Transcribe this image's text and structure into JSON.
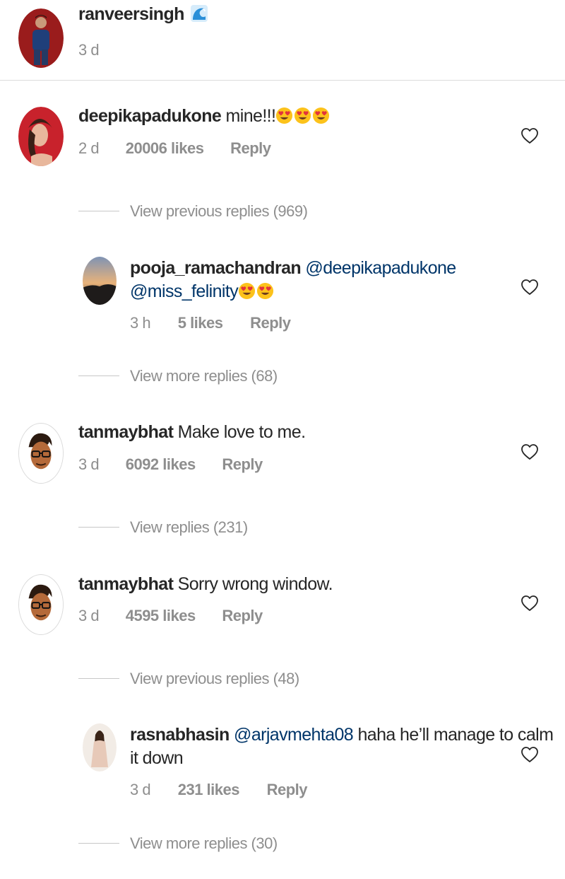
{
  "caption": {
    "username": "ranveersingh",
    "emoji_icon": "wave-emoji",
    "time": "3 d"
  },
  "comments": [
    {
      "username": "deepikapadukone",
      "text": "mine!!!",
      "emoji": "heart-eyes-emoji x3",
      "time": "2 d",
      "likes": "20006 likes",
      "reply": "Reply",
      "view_link": "View previous replies (969)",
      "reply_item": {
        "username": "pooja_ramachandran",
        "mention1": "@deepikapadukone",
        "mention2": "@miss_felinity",
        "emoji": "heart-eyes-emoji x2",
        "time": "3 h",
        "likes": "5 likes",
        "reply": "Reply"
      },
      "more_link": "View more replies (68)"
    },
    {
      "username": "tanmaybhat",
      "text": "Make love to me.",
      "time": "3 d",
      "likes": "6092 likes",
      "reply": "Reply",
      "view_link": "View replies (231)"
    },
    {
      "username": "tanmaybhat",
      "text": "Sorry wrong window.",
      "time": "3 d",
      "likes": "4595 likes",
      "reply": "Reply",
      "view_link": "View previous replies (48)",
      "reply_item": {
        "username": "rasnabhasin",
        "mention": "@arjavmehta08",
        "text_line1": "haha he’ll manage to calm",
        "text_line2": "it down",
        "time": "3 d",
        "likes": "231 likes",
        "reply": "Reply"
      },
      "more_link": "View more replies (30)"
    }
  ],
  "colors": {
    "text": "#262626",
    "secondary": "#8e8e8e",
    "mention": "#003569",
    "divider": "#dbdbdb"
  }
}
